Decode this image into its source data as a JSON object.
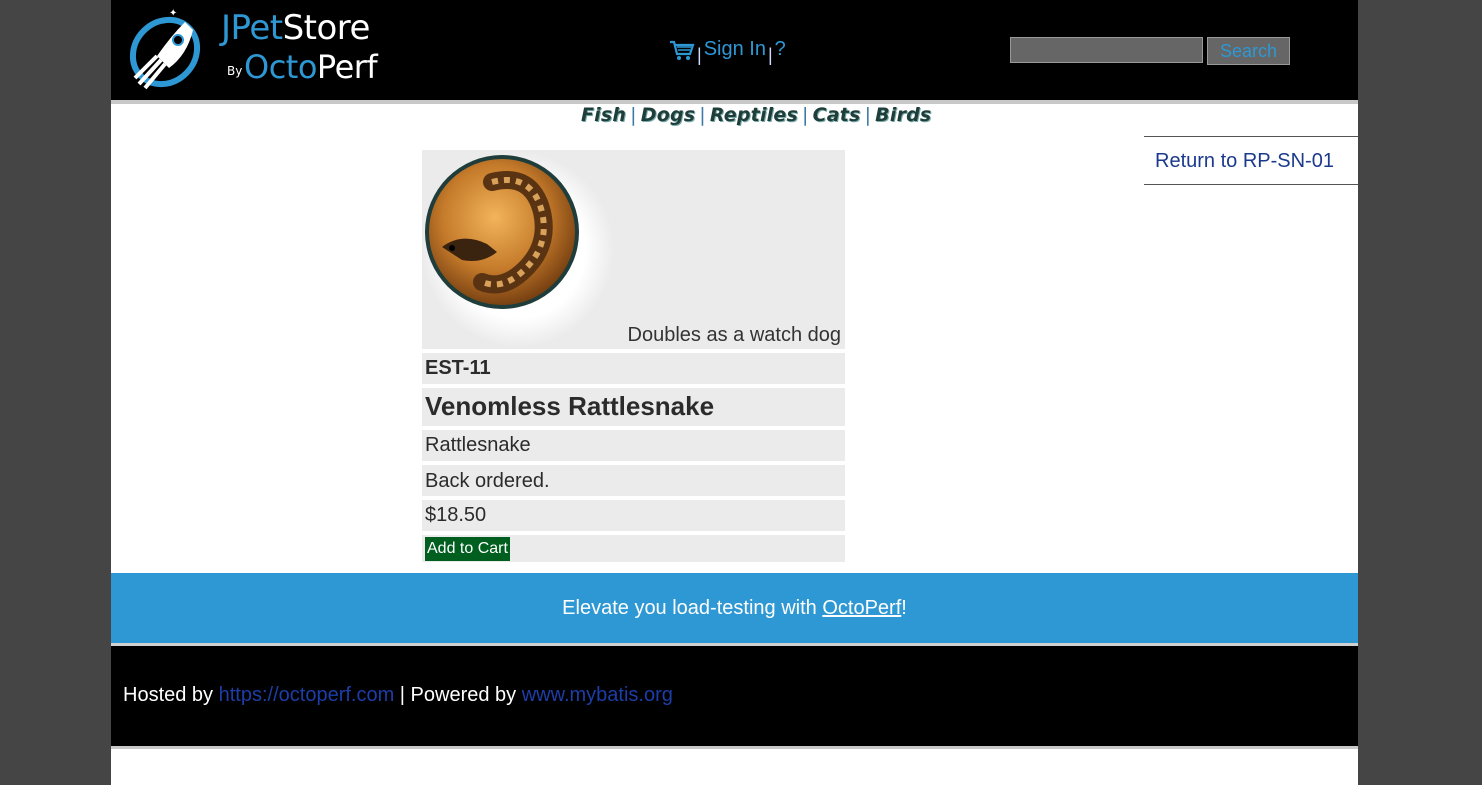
{
  "header": {
    "logo": {
      "title_j": "JPet",
      "title_store": "Store",
      "by": "By",
      "octo": "Octo",
      "perf": "Perf"
    },
    "menu": {
      "cart_icon": "cart-icon",
      "sign_in": "Sign In",
      "separator": "|",
      "help": "?"
    },
    "search": {
      "value": "",
      "button": "Search"
    }
  },
  "categories": {
    "items": [
      "Fish",
      "Dogs",
      "Reptiles",
      "Cats",
      "Birds"
    ],
    "separator": "|"
  },
  "back_link": "Return to RP-SN-01",
  "item": {
    "image_caption": "Doubles as a watch dog",
    "id": "EST-11",
    "name": "Venomless Rattlesnake",
    "product": "Rattlesnake",
    "stock": "Back ordered.",
    "price": "$18.50",
    "add_to_cart": "Add to Cart"
  },
  "banner": {
    "text_before": "Elevate you load-testing with ",
    "link": "OctoPerf",
    "text_after": "!"
  },
  "footer": {
    "hosted_by": "Hosted by ",
    "hosted_link": "https://octoperf.com",
    "powered_by": " | Powered by ",
    "powered_link": "www.mybatis.org"
  },
  "colors": {
    "page_bg": "#454545",
    "header_bg": "#000000",
    "accent_blue": "#2e98d4",
    "add_button": "#005f1f",
    "link_dark_blue": "#1b3a8c",
    "row_bg": "#ebebeb"
  }
}
